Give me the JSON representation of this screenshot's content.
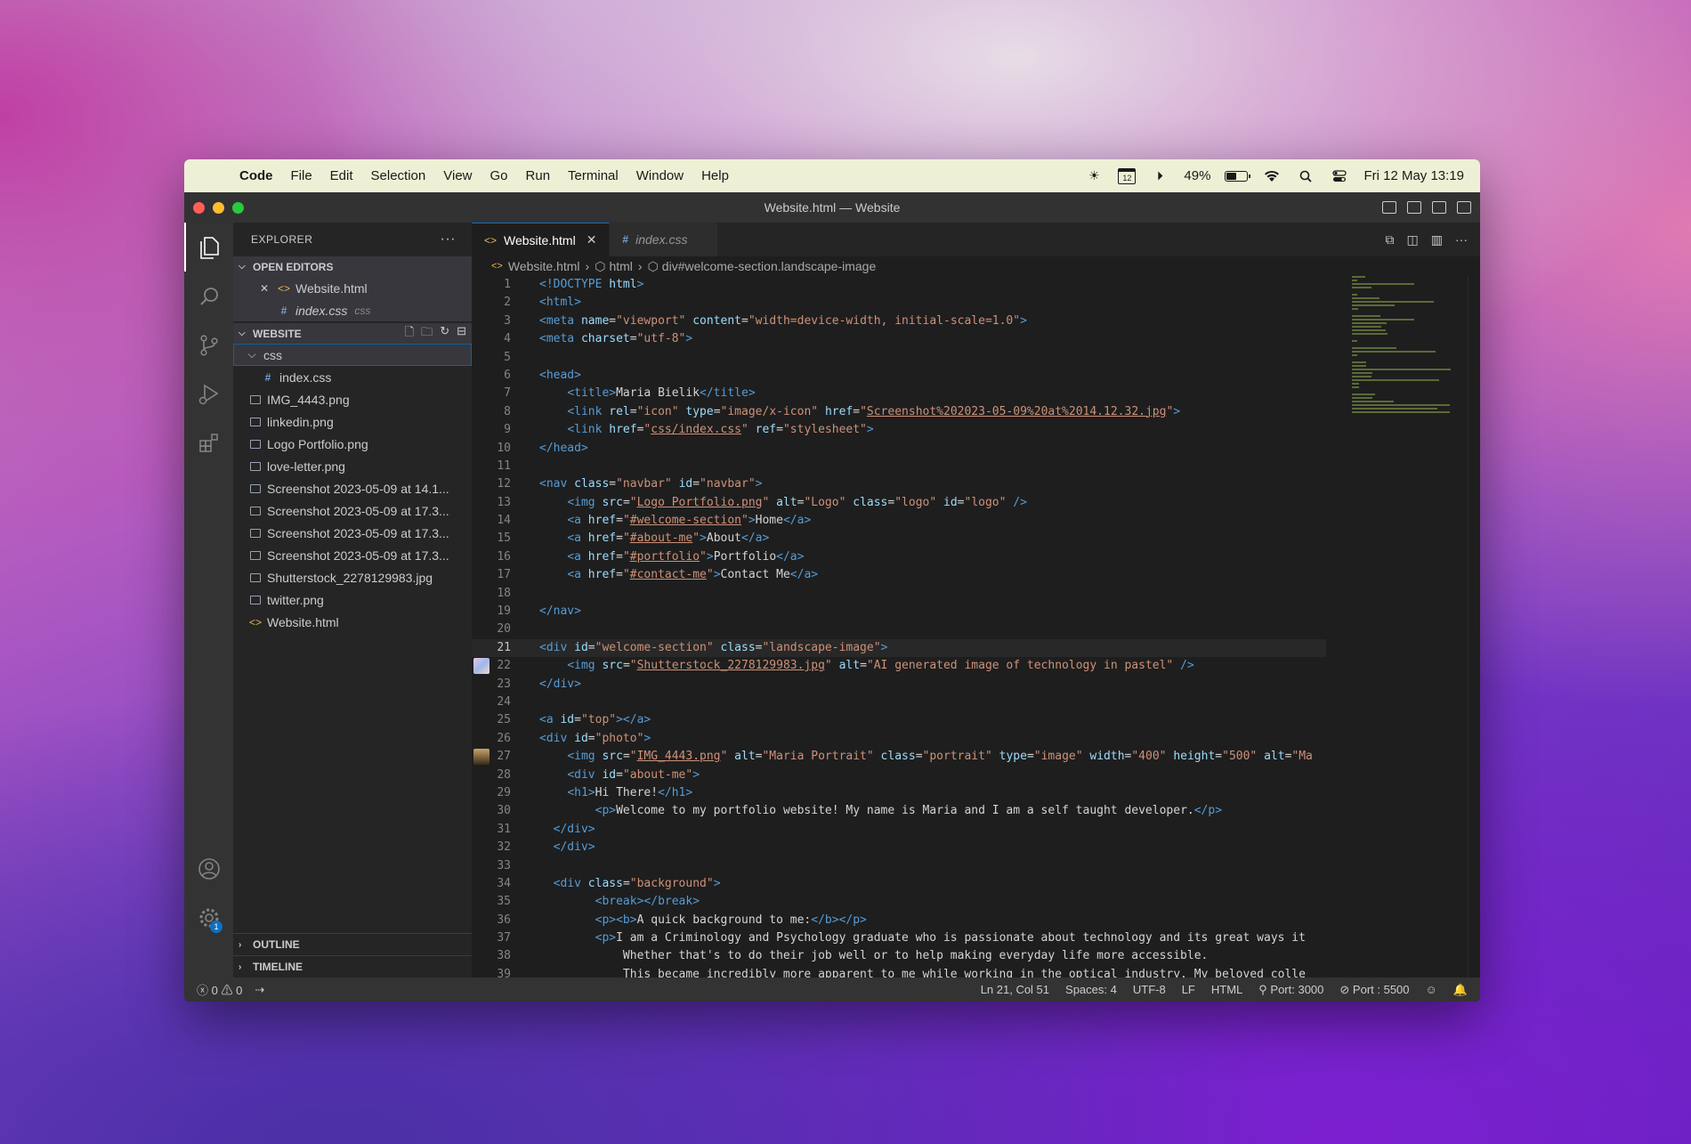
{
  "menubar": {
    "app_name": "Code",
    "items": [
      "File",
      "Edit",
      "Selection",
      "View",
      "Go",
      "Run",
      "Terminal",
      "Window",
      "Help"
    ],
    "battery_percent": "49%",
    "battery_level": 0.49,
    "calendar_day": "12",
    "datetime": "Fri 12 May  13:19"
  },
  "window": {
    "title": "Website.html — Website"
  },
  "sidebar": {
    "header": "EXPLORER",
    "open_editors_label": "OPEN EDITORS",
    "open_editors": [
      {
        "name": "Website.html",
        "hint": ""
      },
      {
        "name": "index.css",
        "hint": "css"
      }
    ],
    "workspace_label": "WEBSITE",
    "folder": "css",
    "folder_files": [
      "index.css"
    ],
    "files": [
      "IMG_4443.png",
      "linkedin.png",
      "Logo Portfolio.png",
      "love-letter.png",
      "Screenshot 2023-05-09 at 14.1...",
      "Screenshot 2023-05-09 at 17.3...",
      "Screenshot 2023-05-09 at 17.3...",
      "Screenshot 2023-05-09 at 17.3...",
      "Shutterstock_2278129983.jpg",
      "twitter.png",
      "Website.html"
    ],
    "outline_label": "OUTLINE",
    "timeline_label": "TIMELINE"
  },
  "activity": {
    "settings_badge": "1"
  },
  "tabs": [
    {
      "label": "Website.html",
      "icon": "html-icon",
      "active": true
    },
    {
      "label": "index.css",
      "icon": "css-hash-icon",
      "active": false
    }
  ],
  "breadcrumb": [
    "Website.html",
    "html",
    "div#welcome-section.landscape-image"
  ],
  "code_colors": {
    "tag": "#569cd6",
    "attr": "#9cdcfe",
    "string": "#ce9178",
    "text": "#d4d4d4",
    "link": "#ce9178",
    "doctype": "#569cd6"
  },
  "code_lines": [
    [
      [
        "tag",
        "<!DOCTYPE "
      ],
      [
        "attr",
        "html"
      ],
      [
        "tag",
        ">"
      ]
    ],
    [
      [
        "tag",
        "<html>"
      ]
    ],
    [
      [
        "tag",
        "<meta "
      ],
      [
        "attr",
        "name"
      ],
      [
        "text",
        "="
      ],
      [
        "string",
        "\"viewport\""
      ],
      [
        "text",
        " "
      ],
      [
        "attr",
        "content"
      ],
      [
        "text",
        "="
      ],
      [
        "string",
        "\"width=device-width, initial-scale=1.0\""
      ],
      [
        "tag",
        ">"
      ]
    ],
    [
      [
        "tag",
        "<meta "
      ],
      [
        "attr",
        "charset"
      ],
      [
        "text",
        "="
      ],
      [
        "string",
        "\"utf-8\""
      ],
      [
        "tag",
        ">"
      ]
    ],
    [],
    [
      [
        "tag",
        "<head>"
      ]
    ],
    [
      [
        "text",
        "    "
      ],
      [
        "tag",
        "<title>"
      ],
      [
        "text",
        "Maria Bielik"
      ],
      [
        "tag",
        "</title>"
      ]
    ],
    [
      [
        "text",
        "    "
      ],
      [
        "tag",
        "<link "
      ],
      [
        "attr",
        "rel"
      ],
      [
        "text",
        "="
      ],
      [
        "string",
        "\"icon\""
      ],
      [
        "text",
        " "
      ],
      [
        "attr",
        "type"
      ],
      [
        "text",
        "="
      ],
      [
        "string",
        "\"image/x-icon\""
      ],
      [
        "text",
        " "
      ],
      [
        "attr",
        "href"
      ],
      [
        "text",
        "="
      ],
      [
        "string",
        "\""
      ],
      [
        "link",
        "Screenshot%202023-05-09%20at%2014.12.32.jpg"
      ],
      [
        "string",
        "\""
      ],
      [
        "tag",
        ">"
      ]
    ],
    [
      [
        "text",
        "    "
      ],
      [
        "tag",
        "<link "
      ],
      [
        "attr",
        "href"
      ],
      [
        "text",
        "="
      ],
      [
        "string",
        "\""
      ],
      [
        "link",
        "css/index.css"
      ],
      [
        "string",
        "\""
      ],
      [
        "text",
        " "
      ],
      [
        "attr",
        "ref"
      ],
      [
        "text",
        "="
      ],
      [
        "string",
        "\"stylesheet\""
      ],
      [
        "tag",
        ">"
      ]
    ],
    [
      [
        "tag",
        "</head>"
      ]
    ],
    [],
    [
      [
        "tag",
        "<nav "
      ],
      [
        "attr",
        "class"
      ],
      [
        "text",
        "="
      ],
      [
        "string",
        "\"navbar\""
      ],
      [
        "text",
        " "
      ],
      [
        "attr",
        "id"
      ],
      [
        "text",
        "="
      ],
      [
        "string",
        "\"navbar\""
      ],
      [
        "tag",
        ">"
      ]
    ],
    [
      [
        "text",
        "    "
      ],
      [
        "tag",
        "<img "
      ],
      [
        "attr",
        "src"
      ],
      [
        "text",
        "="
      ],
      [
        "string",
        "\""
      ],
      [
        "link",
        "Logo Portfolio.png"
      ],
      [
        "string",
        "\""
      ],
      [
        "text",
        " "
      ],
      [
        "attr",
        "alt"
      ],
      [
        "text",
        "="
      ],
      [
        "string",
        "\"Logo\""
      ],
      [
        "text",
        " "
      ],
      [
        "attr",
        "class"
      ],
      [
        "text",
        "="
      ],
      [
        "string",
        "\"logo\""
      ],
      [
        "text",
        " "
      ],
      [
        "attr",
        "id"
      ],
      [
        "text",
        "="
      ],
      [
        "string",
        "\"logo\""
      ],
      [
        "text",
        " "
      ],
      [
        "tag",
        "/>"
      ]
    ],
    [
      [
        "text",
        "    "
      ],
      [
        "tag",
        "<a "
      ],
      [
        "attr",
        "href"
      ],
      [
        "text",
        "="
      ],
      [
        "string",
        "\""
      ],
      [
        "link",
        "#welcome-section"
      ],
      [
        "string",
        "\""
      ],
      [
        "tag",
        ">"
      ],
      [
        "text",
        "Home"
      ],
      [
        "tag",
        "</a>"
      ]
    ],
    [
      [
        "text",
        "    "
      ],
      [
        "tag",
        "<a "
      ],
      [
        "attr",
        "href"
      ],
      [
        "text",
        "="
      ],
      [
        "string",
        "\""
      ],
      [
        "link",
        "#about-me"
      ],
      [
        "string",
        "\""
      ],
      [
        "tag",
        ">"
      ],
      [
        "text",
        "About"
      ],
      [
        "tag",
        "</a>"
      ]
    ],
    [
      [
        "text",
        "    "
      ],
      [
        "tag",
        "<a "
      ],
      [
        "attr",
        "href"
      ],
      [
        "text",
        "="
      ],
      [
        "string",
        "\""
      ],
      [
        "link",
        "#portfolio"
      ],
      [
        "string",
        "\""
      ],
      [
        "tag",
        ">"
      ],
      [
        "text",
        "Portfolio"
      ],
      [
        "tag",
        "</a>"
      ]
    ],
    [
      [
        "text",
        "    "
      ],
      [
        "tag",
        "<a "
      ],
      [
        "attr",
        "href"
      ],
      [
        "text",
        "="
      ],
      [
        "string",
        "\""
      ],
      [
        "link",
        "#contact-me"
      ],
      [
        "string",
        "\""
      ],
      [
        "tag",
        ">"
      ],
      [
        "text",
        "Contact Me"
      ],
      [
        "tag",
        "</a>"
      ]
    ],
    [],
    [
      [
        "tag",
        "</nav>"
      ]
    ],
    [],
    [
      [
        "tag",
        "<div "
      ],
      [
        "attr",
        "id"
      ],
      [
        "text",
        "="
      ],
      [
        "string",
        "\"welcome-section\""
      ],
      [
        "text",
        " "
      ],
      [
        "attr",
        "class"
      ],
      [
        "text",
        "="
      ],
      [
        "string",
        "\"landscape-image\""
      ],
      [
        "tag",
        ">"
      ]
    ],
    [
      [
        "text",
        "    "
      ],
      [
        "tag",
        "<img "
      ],
      [
        "attr",
        "src"
      ],
      [
        "text",
        "="
      ],
      [
        "string",
        "\""
      ],
      [
        "link",
        "Shutterstock_2278129983.jpg"
      ],
      [
        "string",
        "\""
      ],
      [
        "text",
        " "
      ],
      [
        "attr",
        "alt"
      ],
      [
        "text",
        "="
      ],
      [
        "string",
        "\"AI generated image of technology in pastel\""
      ],
      [
        "text",
        " "
      ],
      [
        "tag",
        "/>"
      ]
    ],
    [
      [
        "tag",
        "</div>"
      ]
    ],
    [],
    [
      [
        "tag",
        "<a "
      ],
      [
        "attr",
        "id"
      ],
      [
        "text",
        "="
      ],
      [
        "string",
        "\"top\""
      ],
      [
        "tag",
        "></a>"
      ]
    ],
    [
      [
        "tag",
        "<div "
      ],
      [
        "attr",
        "id"
      ],
      [
        "text",
        "="
      ],
      [
        "string",
        "\"photo\""
      ],
      [
        "tag",
        ">"
      ]
    ],
    [
      [
        "text",
        "    "
      ],
      [
        "tag",
        "<img "
      ],
      [
        "attr",
        "src"
      ],
      [
        "text",
        "="
      ],
      [
        "string",
        "\""
      ],
      [
        "link",
        "IMG_4443.png"
      ],
      [
        "string",
        "\""
      ],
      [
        "text",
        " "
      ],
      [
        "attr",
        "alt"
      ],
      [
        "text",
        "="
      ],
      [
        "string",
        "\"Maria Portrait\""
      ],
      [
        "text",
        " "
      ],
      [
        "attr",
        "class"
      ],
      [
        "text",
        "="
      ],
      [
        "string",
        "\"portrait\""
      ],
      [
        "text",
        " "
      ],
      [
        "attr",
        "type"
      ],
      [
        "text",
        "="
      ],
      [
        "string",
        "\"image\""
      ],
      [
        "text",
        " "
      ],
      [
        "attr",
        "width"
      ],
      [
        "text",
        "="
      ],
      [
        "string",
        "\"400\""
      ],
      [
        "text",
        " "
      ],
      [
        "attr",
        "height"
      ],
      [
        "text",
        "="
      ],
      [
        "string",
        "\"500\""
      ],
      [
        "text",
        " "
      ],
      [
        "attr",
        "alt"
      ],
      [
        "text",
        "="
      ],
      [
        "string",
        "\"Ma"
      ]
    ],
    [
      [
        "text",
        "    "
      ],
      [
        "tag",
        "<div "
      ],
      [
        "attr",
        "id"
      ],
      [
        "text",
        "="
      ],
      [
        "string",
        "\"about-me\""
      ],
      [
        "tag",
        ">"
      ]
    ],
    [
      [
        "text",
        "    "
      ],
      [
        "tag",
        "<h1>"
      ],
      [
        "text",
        "Hi There!"
      ],
      [
        "tag",
        "</h1>"
      ]
    ],
    [
      [
        "text",
        "        "
      ],
      [
        "tag",
        "<p>"
      ],
      [
        "text",
        "Welcome to my portfolio website! My name is Maria and I am a self taught developer."
      ],
      [
        "tag",
        "</p>"
      ]
    ],
    [
      [
        "text",
        "  "
      ],
      [
        "tag",
        "</div>"
      ]
    ],
    [
      [
        "text",
        "  "
      ],
      [
        "tag",
        "</div>"
      ]
    ],
    [],
    [
      [
        "text",
        "  "
      ],
      [
        "tag",
        "<div "
      ],
      [
        "attr",
        "class"
      ],
      [
        "text",
        "="
      ],
      [
        "string",
        "\"background\""
      ],
      [
        "tag",
        ">"
      ]
    ],
    [
      [
        "text",
        "        "
      ],
      [
        "tag",
        "<break></break>"
      ]
    ],
    [
      [
        "text",
        "        "
      ],
      [
        "tag",
        "<p><b>"
      ],
      [
        "text",
        "A quick background to me:"
      ],
      [
        "tag",
        "</b></p>"
      ]
    ],
    [
      [
        "text",
        "        "
      ],
      [
        "tag",
        "<p>"
      ],
      [
        "text",
        "I am a Criminology and Psychology graduate who is passionate about technology and its great ways it"
      ]
    ],
    [
      [
        "text",
        "            Whether that's to do their job well or to help making everyday life more accessible."
      ]
    ],
    [
      [
        "text",
        "            This became incredibly more apparent to me while working in the optical industry. My beloved colle"
      ]
    ]
  ],
  "current_line": 21,
  "gutter_thumbs": {
    "22": "landscape",
    "27": "portrait"
  },
  "status": {
    "errors": "0",
    "warnings": "0",
    "position": "Ln 21, Col 51",
    "spaces": "Spaces: 4",
    "encoding": "UTF-8",
    "eol": "LF",
    "language": "HTML",
    "port1": "Port: 3000",
    "port2": "Port : 5500"
  }
}
